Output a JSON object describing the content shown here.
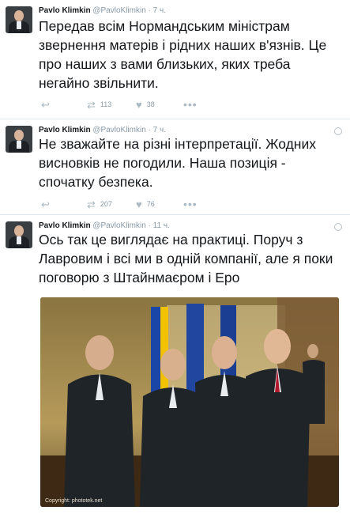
{
  "tweets": [
    {
      "name": "Pavlo Klimkin",
      "handle": "@PavloKlimkin",
      "time": "· 7 ч.",
      "text": "Передав всім Нормандським міністрам звернення матерів і рідних наших в'язнів. Це про наших з вами близьких, яких треба негайно звільнити.",
      "retweets": "113",
      "likes": "38"
    },
    {
      "name": "Pavlo Klimkin",
      "handle": "@PavloKlimkin",
      "time": "· 7 ч.",
      "text": "Не зважайте на різні інтерпретації. Жодних висновків не погодили. Наша позиція - спочатку безпека.",
      "retweets": "207",
      "likes": "76"
    },
    {
      "name": "Pavlo Klimkin",
      "handle": "@PavloKlimkin",
      "time": "· 11 ч.",
      "text": "Ось так це виглядає на практиці. Поруч з Лавровим і всі ми в одній компанії, але я поки поговорю з Штайнмаєром і Еро",
      "photo_credit": "Copyright: phototek.net"
    }
  ],
  "icons": {
    "reply": "reply-icon",
    "retweet": "retweet-icon",
    "like": "heart-icon",
    "more": "more-icon"
  },
  "colors": {
    "background": "#e6ecf0",
    "text": "#14171a",
    "meta": "#8899a6"
  }
}
